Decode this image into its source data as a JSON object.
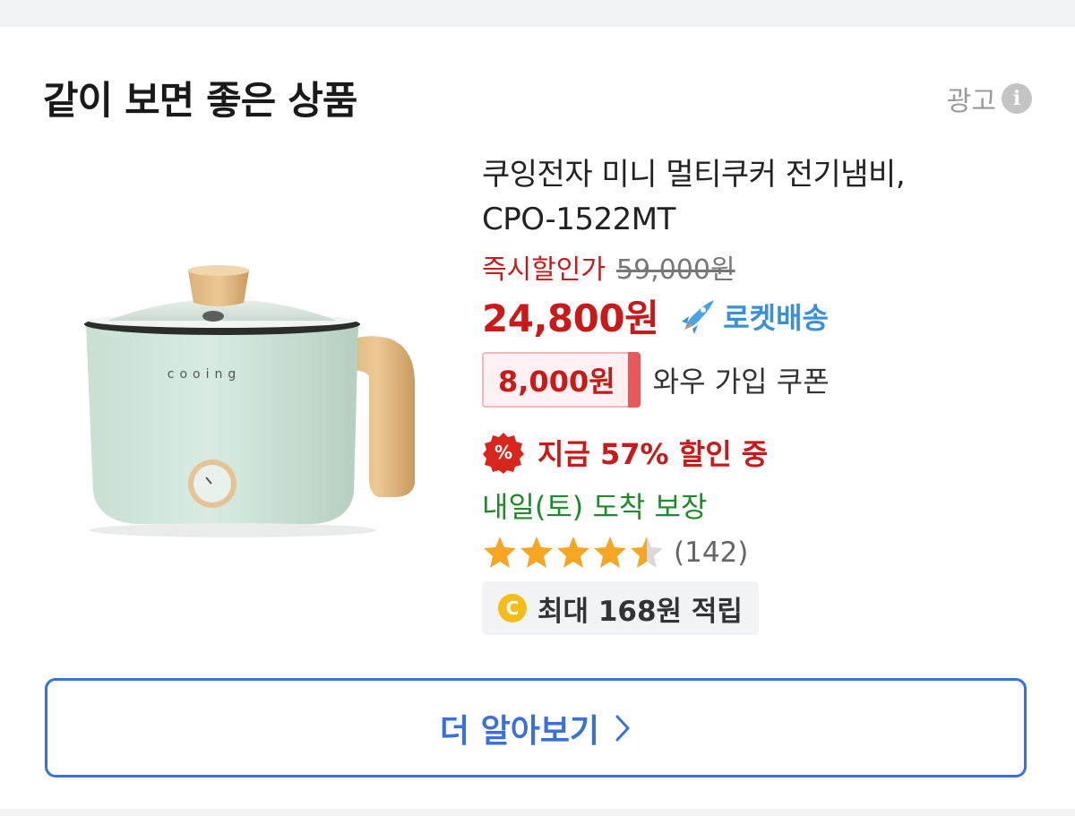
{
  "section": {
    "title": "같이 보면 좋은 상품",
    "ad_label": "광고",
    "info_icon_glyph": "i"
  },
  "product": {
    "name_line1": "쿠잉전자 미니 멀티쿠커 전기냄비,",
    "name_line2": "CPO-1522MT",
    "image_brand_text": "cooing",
    "original_price_label": "즉시할인가",
    "original_price": "59,000원",
    "sale_price": "24,800원",
    "delivery_badge": "로켓배송",
    "coupon_amount": "8,000원",
    "coupon_text": "와우 가입 쿠폰",
    "discount_icon_glyph": "%",
    "discount_text": "지금 57% 할인 중",
    "arrival_text": "내일(토) 도착 보장",
    "rating": 4.5,
    "rating_max": 5,
    "review_count": "(142)",
    "points_icon_glyph": "C",
    "points_text": "최대 168원 적립"
  },
  "more_button": {
    "label": "더 알아보기"
  },
  "colors": {
    "price_red": "#c81a1a",
    "rocket_blue": "#3a8fd6",
    "arrival_green": "#1f8a2a",
    "button_blue": "#3b6fd9",
    "star_gold": "#f6a623"
  },
  "icons": {
    "info": "info-icon",
    "rocket": "rocket-icon",
    "discount": "percent-badge-icon",
    "star": "star-icon",
    "coin": "coin-icon",
    "chevron": "chevron-right-icon"
  }
}
